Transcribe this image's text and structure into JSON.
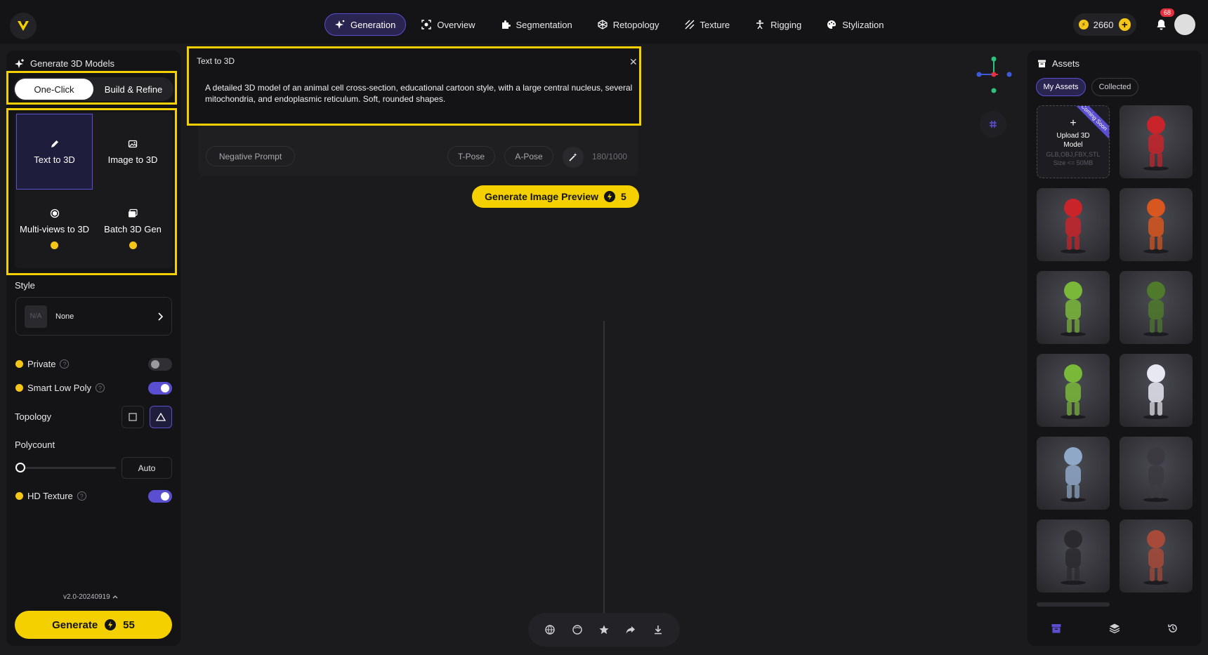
{
  "nav": {
    "items": [
      {
        "label": "Generation",
        "icon": "sparkle-icon",
        "active": true
      },
      {
        "label": "Overview",
        "icon": "scan-icon",
        "active": false
      },
      {
        "label": "Segmentation",
        "icon": "puzzle-icon",
        "active": false
      },
      {
        "label": "Retopology",
        "icon": "mesh-icon",
        "active": false
      },
      {
        "label": "Texture",
        "icon": "texture-icon",
        "active": false
      },
      {
        "label": "Rigging",
        "icon": "figure-icon",
        "active": false
      },
      {
        "label": "Stylization",
        "icon": "palette-icon",
        "active": false
      }
    ],
    "credits": "2660",
    "notifications": "68"
  },
  "left": {
    "title": "Generate 3D Models",
    "toggle": {
      "one_click": "One-Click",
      "build_refine": "Build & Refine"
    },
    "modes": [
      {
        "label": "Text to 3D",
        "icon": "pencil-icon",
        "selected": true,
        "pro": false
      },
      {
        "label": "Image to 3D",
        "icon": "image-icon",
        "selected": false,
        "pro": false
      },
      {
        "label": "Multi-views to 3D",
        "icon": "multiview-icon",
        "selected": false,
        "pro": true
      },
      {
        "label": "Batch 3D Gen",
        "icon": "batch-icon",
        "selected": false,
        "pro": true
      }
    ],
    "style_label": "Style",
    "style_thumb": "N/A",
    "style_value": "None",
    "private_label": "Private",
    "private_on": false,
    "smart_low_poly_label": "Smart Low Poly",
    "smart_low_poly_on": true,
    "topology_label": "Topology",
    "polycount_label": "Polycount",
    "polycount_value": "Auto",
    "polycount_fraction": 0,
    "hd_texture_label": "HD Texture",
    "hd_texture_on": true,
    "version": "v2.0-20240919",
    "generate_label": "Generate",
    "generate_cost": "55"
  },
  "prompt": {
    "title": "Text to 3D",
    "text": "A detailed 3D model of an animal cell cross-section, educational cartoon style, with a large central nucleus, several mitochondria, and endoplasmic reticulum. Soft, rounded shapes.",
    "negative_prompt": "Negative Prompt",
    "t_pose": "T-Pose",
    "a_pose": "A-Pose",
    "counter": "180/1000",
    "preview_label": "Generate Image Preview",
    "preview_cost": "5"
  },
  "assets": {
    "title": "Assets",
    "tabs": [
      "My Assets",
      "Collected"
    ],
    "upload": {
      "title": "Upload 3D Model",
      "formats": "GLB,OBJ,FBX,STL",
      "size": "Size <= 50MB",
      "ribbon": "Coming Soon"
    },
    "items": [
      {
        "icon": "plumber-figure-icon",
        "color": "#c8242a"
      },
      {
        "icon": "plumber-figure-icon",
        "color": "#c8242a"
      },
      {
        "icon": "robot-figure-icon",
        "color": "#d8561f"
      },
      {
        "icon": "dino-astronaut-icon",
        "color": "#7ab83a"
      },
      {
        "icon": "green-helmet-figure-icon",
        "color": "#4f7a2c"
      },
      {
        "icon": "dino-astronaut-icon",
        "color": "#7ab83a"
      },
      {
        "icon": "white-earbud-icon",
        "color": "#e8e8f2"
      },
      {
        "icon": "blue-pod-icon",
        "color": "#8fa8c8"
      },
      {
        "icon": "dark-tpose-figure-icon",
        "color": "#3a3a40"
      },
      {
        "icon": "dark-tpose-figure-icon",
        "color": "#2a2a2e"
      },
      {
        "icon": "hat-figure-icon",
        "color": "#a84a3a"
      }
    ]
  }
}
